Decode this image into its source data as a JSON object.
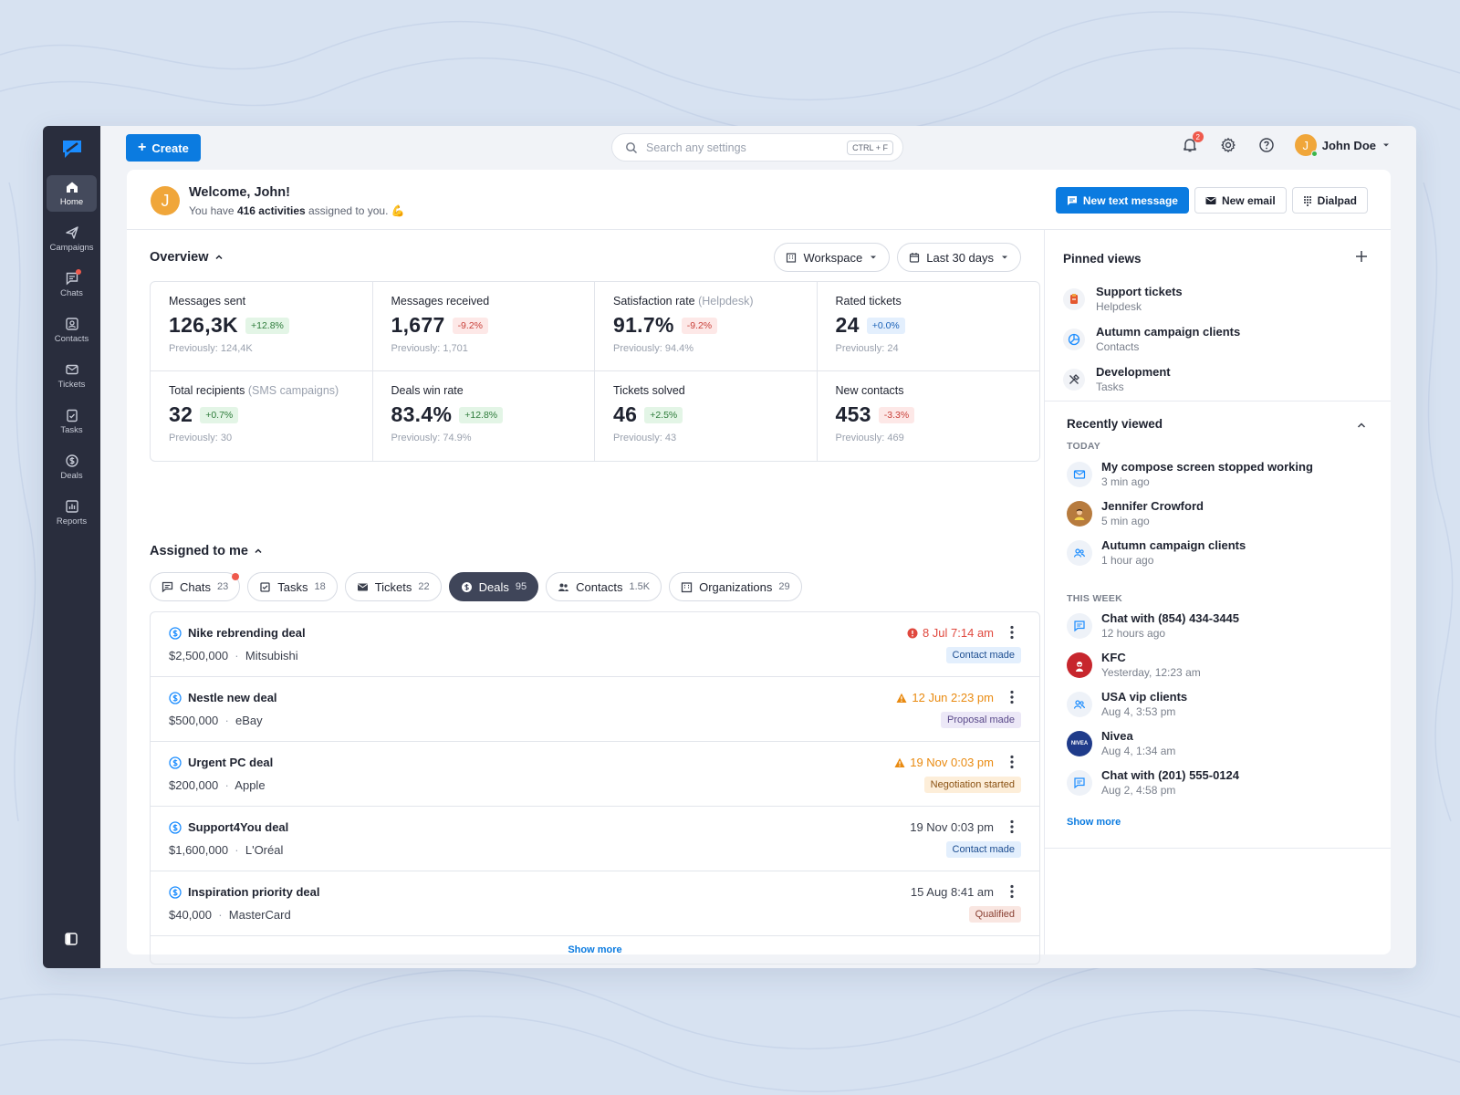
{
  "sidebar": {
    "items": [
      {
        "label": "Home",
        "icon": "home-icon",
        "active": true
      },
      {
        "label": "Campaigns",
        "icon": "send-icon"
      },
      {
        "label": "Chats",
        "icon": "chat-icon",
        "dot": true
      },
      {
        "label": "Contacts",
        "icon": "contact-icon"
      },
      {
        "label": "Tickets",
        "icon": "mail-icon"
      },
      {
        "label": "Tasks",
        "icon": "clipboard-icon"
      },
      {
        "label": "Deals",
        "icon": "dollar-icon"
      },
      {
        "label": "Reports",
        "icon": "chart-icon"
      }
    ]
  },
  "topbar": {
    "create_label": "Create",
    "search_placeholder": "Search any settings",
    "search_shortcut": "CTRL + F",
    "notifications_count": "2",
    "user_initial": "J",
    "user_name": "John Doe"
  },
  "welcome": {
    "initial": "J",
    "title": "Welcome, John!",
    "text_before": "You have ",
    "activities": "416 activities",
    "text_after": " assigned to you. 💪",
    "btn_text_message": "New text message",
    "btn_email": "New email",
    "btn_dialpad": "Dialpad"
  },
  "overview": {
    "title": "Overview",
    "filter_workspace": "Workspace",
    "filter_range": "Last 30 days",
    "stats": [
      {
        "label": "Messages sent",
        "label_extra": "",
        "value": "126,3K",
        "change": "+12.8%",
        "trend": "up",
        "previous": "Previously: 124,4K"
      },
      {
        "label": "Messages received",
        "label_extra": "",
        "value": "1,677",
        "change": "-9.2%",
        "trend": "down",
        "previous": "Previously: 1,701"
      },
      {
        "label": "Satisfaction rate ",
        "label_extra": "(Helpdesk)",
        "value": "91.7%",
        "change": "-9.2%",
        "trend": "down",
        "previous": "Previously: 94.4%"
      },
      {
        "label": "Rated tickets",
        "label_extra": "",
        "value": "24",
        "change": "+0.0%",
        "trend": "neutral",
        "previous": "Previously: 24"
      },
      {
        "label": "Total recipients ",
        "label_extra": "(SMS campaigns)",
        "value": "32",
        "change": "+0.7%",
        "trend": "up",
        "previous": "Previously: 30"
      },
      {
        "label": "Deals win rate",
        "label_extra": "",
        "value": "83.4%",
        "change": "+12.8%",
        "trend": "up",
        "previous": "Previously: 74.9%"
      },
      {
        "label": "Tickets solved",
        "label_extra": "",
        "value": "46",
        "change": "+2.5%",
        "trend": "up",
        "previous": "Previously: 43"
      },
      {
        "label": "New contacts",
        "label_extra": "",
        "value": "453",
        "change": "-3.3%",
        "trend": "down",
        "previous": "Previously: 469"
      }
    ]
  },
  "assigned": {
    "title": "Assigned to me",
    "tabs": [
      {
        "label": "Chats",
        "count": "23",
        "dot": true
      },
      {
        "label": "Tasks",
        "count": "18"
      },
      {
        "label": "Tickets",
        "count": "22"
      },
      {
        "label": "Deals",
        "count": "95",
        "active": true
      },
      {
        "label": "Contacts",
        "count": "1.5K"
      },
      {
        "label": "Organizations",
        "count": "29"
      }
    ],
    "deals": [
      {
        "name": "Nike rebrending deal",
        "amount": "$2,500,000",
        "company": "Mitsubishi",
        "date": "8 Jul 7:14 am",
        "urgency": "red",
        "status": "Contact made",
        "status_color": "blue"
      },
      {
        "name": "Nestle new deal",
        "amount": "$500,000",
        "company": "eBay",
        "date": "12 Jun 2:23 pm",
        "urgency": "orange",
        "status": "Proposal made",
        "status_color": "purple"
      },
      {
        "name": "Urgent PC deal",
        "amount": "$200,000",
        "company": "Apple",
        "date": "19 Nov 0:03 pm",
        "urgency": "orange",
        "status": "Negotiation started",
        "status_color": "orange"
      },
      {
        "name": "Support4You deal",
        "amount": "$1,600,000",
        "company": "L'Oréal",
        "date": "19 Nov 0:03 pm",
        "urgency": "none",
        "status": "Contact made",
        "status_color": "blue"
      },
      {
        "name": "Inspiration priority deal",
        "amount": "$40,000",
        "company": "MasterCard",
        "date": "15 Aug 8:41 am",
        "urgency": "none",
        "status": "Qualified",
        "status_color": "pink"
      }
    ],
    "show_more": "Show more"
  },
  "pinned": {
    "title": "Pinned views",
    "items": [
      {
        "title": "Support tickets",
        "sub": "Helpdesk",
        "icon": "lifebuoy-icon"
      },
      {
        "title": "Autumn campaign clients",
        "sub": "Contacts",
        "icon": "pie-icon"
      },
      {
        "title": "Development",
        "sub": "Tasks",
        "icon": "tools-icon"
      }
    ]
  },
  "recent": {
    "title": "Recently viewed",
    "group_today": "TODAY",
    "group_week": "THIS WEEK",
    "today": [
      {
        "title": "My compose screen stopped working",
        "sub": "3 min ago",
        "icon": "mail-icon"
      },
      {
        "title": "Jennifer Crowford",
        "sub": "5 min ago",
        "icon": "avatar-photo"
      },
      {
        "title": "Autumn campaign clients",
        "sub": "1 hour ago",
        "icon": "users-icon"
      }
    ],
    "week": [
      {
        "title": "Chat with (854) 434-3445",
        "sub": "12 hours ago",
        "icon": "chat-icon"
      },
      {
        "title": "KFC",
        "sub": "Yesterday, 12:23 am",
        "icon": "kfc-logo"
      },
      {
        "title": "USA vip clients",
        "sub": "Aug 4, 3:53 pm",
        "icon": "users-icon"
      },
      {
        "title": "Nivea",
        "sub": "Aug 4, 1:34 am",
        "icon": "nivea-logo",
        "logo_text": "NIVEA"
      },
      {
        "title": "Chat with (201) 555-0124",
        "sub": "Aug 2, 4:58 pm",
        "icon": "chat-icon"
      }
    ],
    "show_more": "Show more"
  },
  "colors": {
    "accent": "#0b7be0",
    "sidebar": "#292d3d",
    "background": "#d7e2f1"
  }
}
